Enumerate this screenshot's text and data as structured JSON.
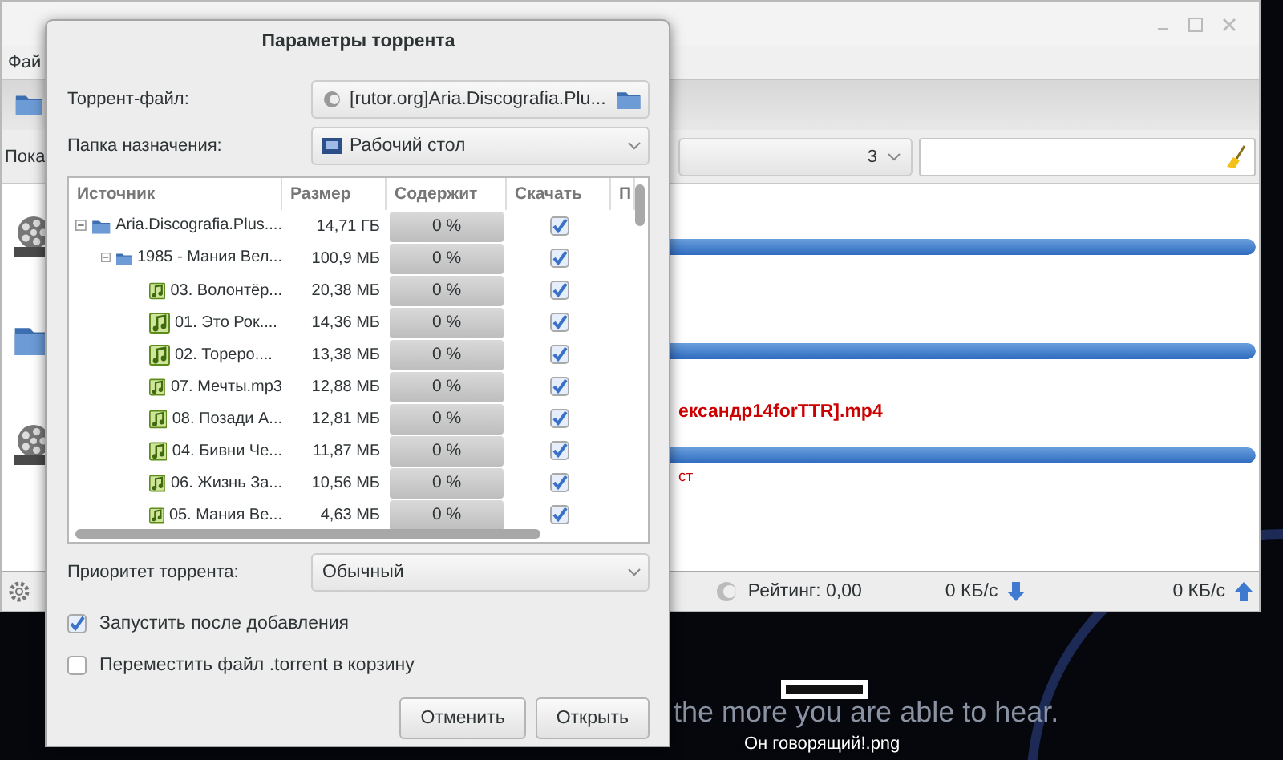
{
  "desktop": {
    "wallpaper_text": "the more you are able to hear.",
    "icons": [
      {
        "label": "Он говорящий!.png"
      }
    ]
  },
  "main_window": {
    "menu": [
      "Фай"
    ],
    "filter_label": "Пока",
    "filter_combo": "3",
    "torrents": [
      {
        "kind": "video",
        "level": 1
      },
      {
        "kind": "folder",
        "level": 1
      },
      {
        "kind": "video",
        "name": "ександр14forTTR].mp4",
        "status": "ст",
        "error": true,
        "level": 1
      }
    ],
    "status_bar": {
      "rating": "Рейтинг: 0,00",
      "download": "0 КБ/с",
      "upload": "0 КБ/с"
    }
  },
  "dialog": {
    "title": "Параметры торрента",
    "torrent_file_label": "Торрент-файл:",
    "torrent_file": "[rutor.org]Aria.Discografia.Plu...",
    "folder_label": "Папка назначения:",
    "folder": "Рабочий стол",
    "columns": [
      "Источник",
      "Размер",
      "Содержит",
      "Скачать",
      "П"
    ],
    "files": [
      {
        "kind": "folder",
        "name": "Aria.Discografia.Plus....",
        "size": "14,71 ГБ",
        "progress": "0 %",
        "level": 0,
        "download": true,
        "expanded": true,
        "children": [
          {
            "kind": "folder",
            "name": "1985 - Мания Вел...",
            "size": "100,9 МБ",
            "progress": "0 %",
            "level": 0,
            "download": true,
            "expanded": true,
            "children": [
              {
                "kind": "audio",
                "name": "03. Волонтёр...",
                "size": "20,38 МБ",
                "progress": "0 %",
                "level": 0,
                "download": true
              },
              {
                "kind": "audio",
                "name": "01. Это Рок....",
                "size": "14,36 МБ",
                "progress": "0 %",
                "level": 0,
                "download": true
              },
              {
                "kind": "audio",
                "name": "02. Тореро....",
                "size": "13,38 МБ",
                "progress": "0 %",
                "level": 0,
                "download": true
              },
              {
                "kind": "audio",
                "name": "07. Мечты.mp3",
                "size": "12,88 МБ",
                "progress": "0 %",
                "level": 0,
                "download": true
              },
              {
                "kind": "audio",
                "name": "08. Позади А...",
                "size": "12,81 МБ",
                "progress": "0 %",
                "level": 0,
                "download": true
              },
              {
                "kind": "audio",
                "name": "04. Бивни Че...",
                "size": "11,87 МБ",
                "progress": "0 %",
                "level": 0,
                "download": true
              },
              {
                "kind": "audio",
                "name": "06. Жизнь За...",
                "size": "10,56 МБ",
                "progress": "0 %",
                "level": 0,
                "download": true
              },
              {
                "kind": "audio",
                "name": "05. Мания Ве...",
                "size": "4,63 МБ",
                "progress": "0 %",
                "level": 0,
                "download": true
              }
            ]
          }
        ]
      }
    ],
    "priority_label": "Приоритет торрента:",
    "priority": "Обычный",
    "options": [
      {
        "label": "Запустить после добавления",
        "checked": true
      },
      {
        "label": "Переместить файл .torrent в корзину",
        "checked": false
      }
    ],
    "buttons": [
      "Отменить",
      "Открыть"
    ]
  }
}
